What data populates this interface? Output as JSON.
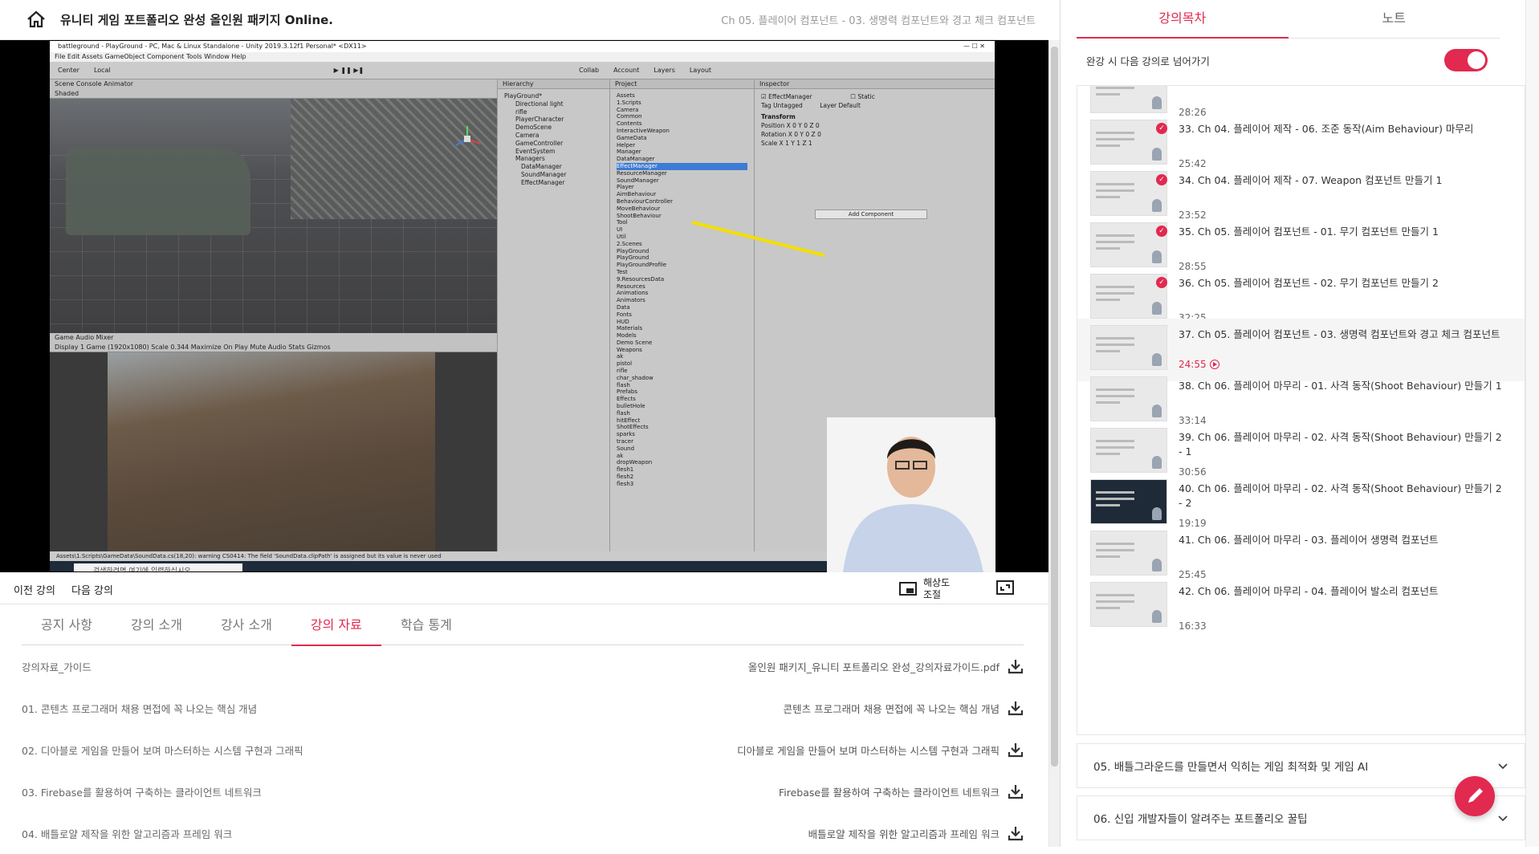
{
  "header": {
    "course_title": "유니티 게임 포트폴리오 완성 올인원 패키지 Online.",
    "lecture_title": "Ch 05. 플레이어 컴포넌트 - 03. 생명력 컴포넌트와 경고 체크 컴포넌트"
  },
  "video": {
    "unity_window_title": "battleground - PlayGround - PC, Mac & Linux Standalone - Unity 2019.3.12f1 Personal* <DX11>",
    "unity_menu": "File  Edit  Assets  GameObject  Component  Tools  Window  Help",
    "toolbar_center": "Center",
    "toolbar_local": "Local",
    "toolbar_collab": "Collab",
    "toolbar_account": "Account",
    "toolbar_layers": "Layers",
    "toolbar_layout": "Layout",
    "scene_tabs": "Scene   Console   Animator",
    "scene_shading": "Shaded",
    "game_tabs": "Game   Audio Mixer",
    "game_display": "Display 1   Game (1920x1080)   Scale 0.344   Maximize On Play  Mute Audio  Stats  Gizmos",
    "hierarchy_title": "Hierarchy",
    "hierarchy_items": [
      "PlayGround*",
      "Directional light",
      "rifle",
      "PlayerCharacter",
      "DemoScene",
      "Camera",
      "GameController",
      "EventSystem",
      "Managers",
      "DataManager",
      "SoundManager",
      "EffectManager"
    ],
    "project_title": "Project",
    "project_items": [
      "Assets",
      "1.Scripts",
      "Camera",
      "Common",
      "Contents",
      "InteractiveWeapon",
      "GameData",
      "Helper",
      "Manager",
      "DataManager",
      "EffectManager",
      "ResourceManager",
      "SoundManager",
      "Player",
      "AimBehaviour",
      "BehaviourController",
      "MoveBehaviour",
      "ShootBehaviour",
      "Tool",
      "UI",
      "Util",
      "2.Scenes",
      "PlayGround",
      "PlayGround",
      "PlayGroundProfile",
      "Test",
      "9.ResourcesData",
      "Resources",
      "Animations",
      "Animators",
      "Data",
      "Fonts",
      "HUD",
      "Materials",
      "Models",
      "Demo Scene",
      "Weapons",
      "ak",
      "pistol",
      "rifle",
      "char_shadow",
      "flash",
      "Prefabs",
      "Effects",
      "bulletHole",
      "flash",
      "hitEffect",
      "ShotEffects",
      "sparks",
      "tracer",
      "Sound",
      "ak",
      "dropWeapon",
      "flesh1",
      "flesh2",
      "flesh3"
    ],
    "inspector_title": "Inspector",
    "inspector_object": "EffectManager",
    "inspector_static": "Static",
    "inspector_tag": "Tag  Untagged",
    "inspector_layer": "Layer  Default",
    "inspector_transform": "Transform",
    "inspector_position": "Position   X 0   Y 0   Z 0",
    "inspector_rotation": "Rotation   X 0   Y 0   Z 0",
    "inspector_scale": "Scale   X 1   Y 1   Z 1",
    "add_component": "Add Component",
    "console_message": "Assets\\1.Scripts\\GameData\\SoundData.cs(18,20): warning CS0414: The field 'SoundData.clipPath' is assigned but its value is never used",
    "taskbar_search": "검색하려면 여기에 입력하십시오."
  },
  "controls": {
    "prev_label": "이전 강의",
    "next_label": "다음 강의",
    "resolution_label": "해상도 조절"
  },
  "tabs": [
    {
      "label": "공지 사항"
    },
    {
      "label": "강의 소개"
    },
    {
      "label": "강사 소개"
    },
    {
      "label": "강의 자료"
    },
    {
      "label": "학습 통계"
    }
  ],
  "materials": [
    {
      "name": "강의자료_가이드",
      "file": "올인원 패키지_유니티 포트폴리오 완성_강의자료가이드.pdf"
    },
    {
      "name": "01. 콘텐츠 프로그래머 채용 면접에 꼭 나오는 핵심 개념",
      "file": "콘텐츠 프로그래머 채용 면접에 꼭 나오는 핵심 개념"
    },
    {
      "name": "02. 디아블로 게임을 만들어 보며 마스터하는 시스템 구현과 그래픽",
      "file": "디아블로 게임을 만들어 보며 마스터하는 시스템 구현과 그래픽"
    },
    {
      "name": "03. Firebase를 활용하여 구축하는 클라이언트 네트워크",
      "file": "Firebase를 활용하여 구축하는 클라이언트 네트워크"
    },
    {
      "name": "04. 배틀로얄 제작을 위한 알고리즘과 프레임 워크",
      "file": "배틀로얄 제작을 위한 알고리즘과 프레임 워크"
    }
  ],
  "sidebar": {
    "tab_toc": "강의목차",
    "tab_notes": "노트",
    "autoplay_label": "완강 시 다음 강의로 넘어가기",
    "lectures": [
      {
        "title": "",
        "duration": "28:26",
        "done": false
      },
      {
        "title": "33. Ch 04. 플레이어 제작 - 06. 조준 동작(Aim Behaviour) 마무리",
        "duration": "25:42",
        "done": true
      },
      {
        "title": "34. Ch 04. 플레이어 제작 - 07. Weapon 컴포넌트 만들기 1",
        "duration": "23:52",
        "done": true
      },
      {
        "title": "35. Ch 05. 플레이어 컴포넌트 - 01. 무기 컴포넌트 만들기 1",
        "duration": "28:55",
        "done": true
      },
      {
        "title": "36. Ch 05. 플레이어 컴포넌트 - 02. 무기 컴포넌트 만들기 2",
        "duration": "32:25",
        "done": true
      },
      {
        "title": "37. Ch 05. 플레이어 컴포넌트 - 03. 생명력 컴포넌트와 경고 체크 컴포넌트",
        "duration": "24:55",
        "done": false
      },
      {
        "title": "38. Ch 06. 플레이어 마무리 - 01. 사격 동작(Shoot Behaviour) 만들기 1",
        "duration": "33:14",
        "done": false
      },
      {
        "title": "39. Ch 06. 플레이어 마무리 - 02. 사격 동작(Shoot Behaviour) 만들기 2 - 1",
        "duration": "30:56",
        "done": false
      },
      {
        "title": "40. Ch 06. 플레이어 마무리 - 02. 사격 동작(Shoot Behaviour) 만들기 2 - 2",
        "duration": "19:19",
        "done": false
      },
      {
        "title": "41. Ch 06. 플레이어 마무리 - 03. 플레이어 생명력 컴포넌트",
        "duration": "25:45",
        "done": false
      },
      {
        "title": "42. Ch 06. 플레이어 마무리 - 04. 플레이어 발소리 컴포넌트",
        "duration": "16:33",
        "done": false
      }
    ],
    "sections": [
      {
        "title": "05. 배틀그라운드를 만들면서 익히는 게임 최적화 및 게임 AI"
      },
      {
        "title": "06. 신입 개발자들이 알려주는 포트폴리오 꿀팁"
      }
    ]
  },
  "colors": {
    "accent": "#e2294f",
    "text": "#333333",
    "muted": "#999999"
  }
}
